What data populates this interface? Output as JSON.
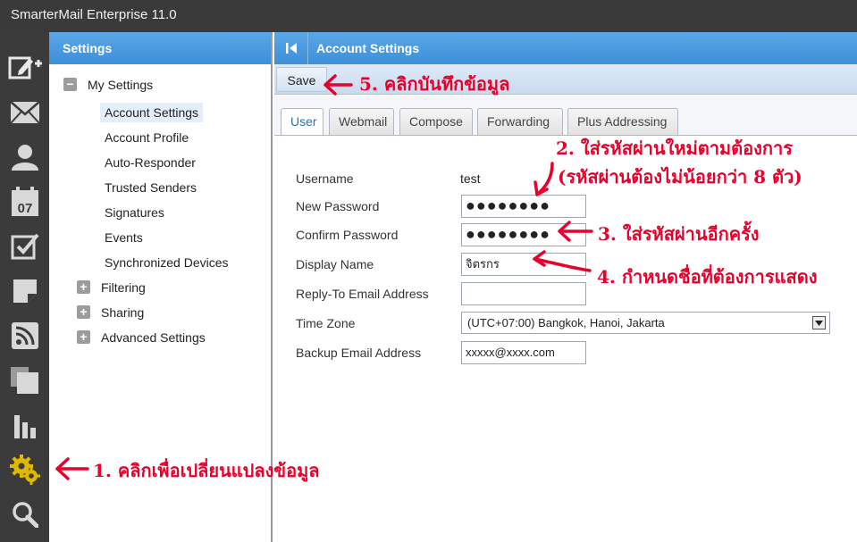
{
  "app": {
    "title": "SmarterMail Enterprise 11.0"
  },
  "rail": {
    "icons": [
      "compose-icon",
      "mail-icon",
      "contacts-icon",
      "calendar-icon",
      "tasks-icon",
      "notes-icon",
      "rss-icon",
      "files-icon",
      "reports-icon",
      "settings-icon",
      "search-icon"
    ],
    "calendar_day": "07"
  },
  "sidebar": {
    "title": "Settings",
    "my_settings": "My Settings",
    "items": [
      "Account Settings",
      "Account Profile",
      "Auto-Responder",
      "Trusted Senders",
      "Signatures",
      "Events",
      "Synchronized Devices"
    ],
    "groups": [
      "Filtering",
      "Sharing",
      "Advanced Settings"
    ]
  },
  "main": {
    "title": "Account Settings",
    "save_label": "Save",
    "tabs": [
      "User",
      "Webmail",
      "Compose",
      "Forwarding",
      "Plus Addressing"
    ],
    "active_tab": "User"
  },
  "form": {
    "username_label": "Username",
    "username_value": "test",
    "new_password_label": "New Password",
    "new_password_value": "●●●●●●●●",
    "confirm_password_label": "Confirm Password",
    "confirm_password_value": "●●●●●●●●",
    "display_name_label": "Display Name",
    "display_name_value": "จิตรกร",
    "reply_to_label": "Reply-To Email Address",
    "reply_to_value": "",
    "time_zone_label": "Time Zone",
    "time_zone_value": "(UTC+07:00) Bangkok, Hanoi, Jakarta",
    "backup_email_label": "Backup Email Address",
    "backup_email_value": "xxxxx@xxxx.com"
  },
  "annotations": {
    "step1": "1. คลิกเพื่อเปลี่ยนแปลงข้อมูล",
    "step2_line1": "2. ใส่รหัสผ่านใหม่ตามต้องการ",
    "step2_line2": "(รหัสผ่านต้องไม่น้อยกว่า 8 ตัว)",
    "step3": "3. ใส่รหัสผ่านอีกครั้ง",
    "step4": "4. กำหนดชื่อที่ต้องการแสดง",
    "step5": "5. คลิกบันทึกข้อมูล",
    "color": "#e8002a"
  },
  "colors": {
    "header_blue": "#3c8fd9",
    "rail_bg": "#3b3b3b",
    "settings_icon": "#e0b800"
  }
}
